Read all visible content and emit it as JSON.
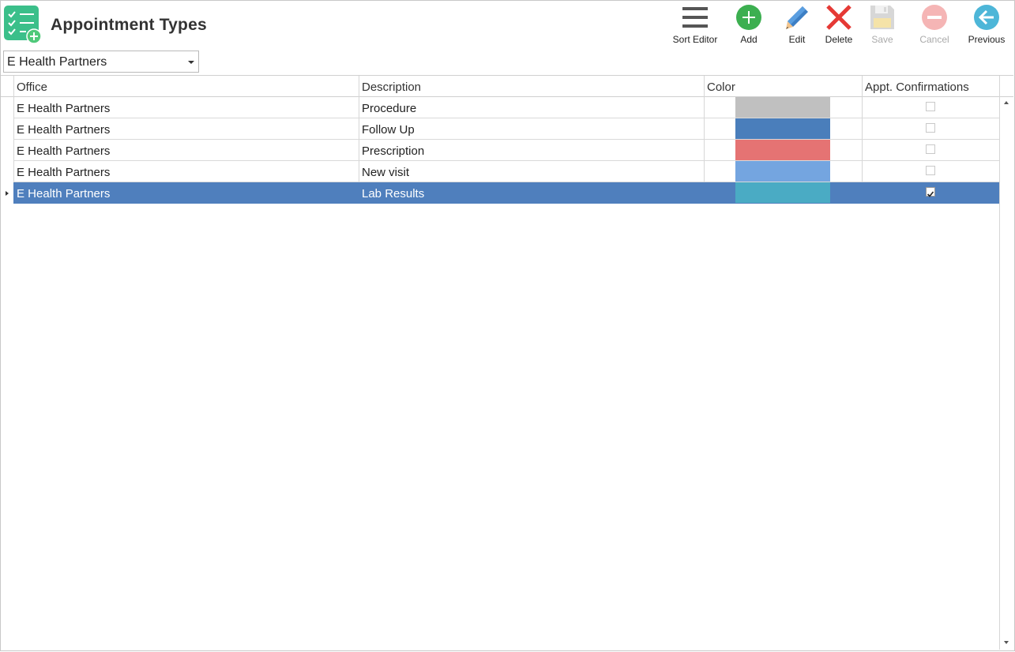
{
  "header": {
    "title": "Appointment Types"
  },
  "toolbar": {
    "sort_editor": "Sort Editor",
    "add": "Add",
    "edit": "Edit",
    "delete": "Delete",
    "save": "Save",
    "cancel": "Cancel",
    "previous": "Previous"
  },
  "office_selector": {
    "value": "E Health Partners"
  },
  "grid": {
    "columns": [
      "Office",
      "Description",
      "Color",
      "Appt. Confirmations"
    ],
    "rows": [
      {
        "office": "E Health Partners",
        "description": "Procedure",
        "color": "#c0c0c0",
        "confirmations": false
      },
      {
        "office": "E Health Partners",
        "description": "Follow Up",
        "color": "#4a7ebb",
        "confirmations": false
      },
      {
        "office": "E Health Partners",
        "description": "Prescription",
        "color": "#e57373",
        "confirmations": false
      },
      {
        "office": "E Health Partners",
        "description": "New visit",
        "color": "#74a5e0",
        "confirmations": false
      },
      {
        "office": "E Health Partners",
        "description": "Lab Results",
        "color": "#4aabc4",
        "confirmations": true
      }
    ],
    "selected_row": 4
  },
  "icons": {
    "app": "checklist-add-icon",
    "sort_editor": "hamburger-icon",
    "add": "plus-circle-icon",
    "edit": "pencil-icon",
    "delete": "x-icon",
    "save": "floppy-disk-icon",
    "cancel": "minus-circle-icon",
    "previous": "arrow-left-circle-icon"
  },
  "colors": {
    "accent": "#4f7fbd",
    "app_icon": "#3bbf8a",
    "add": "#3caf50",
    "delete": "#e53935",
    "previous": "#4db6d8"
  }
}
